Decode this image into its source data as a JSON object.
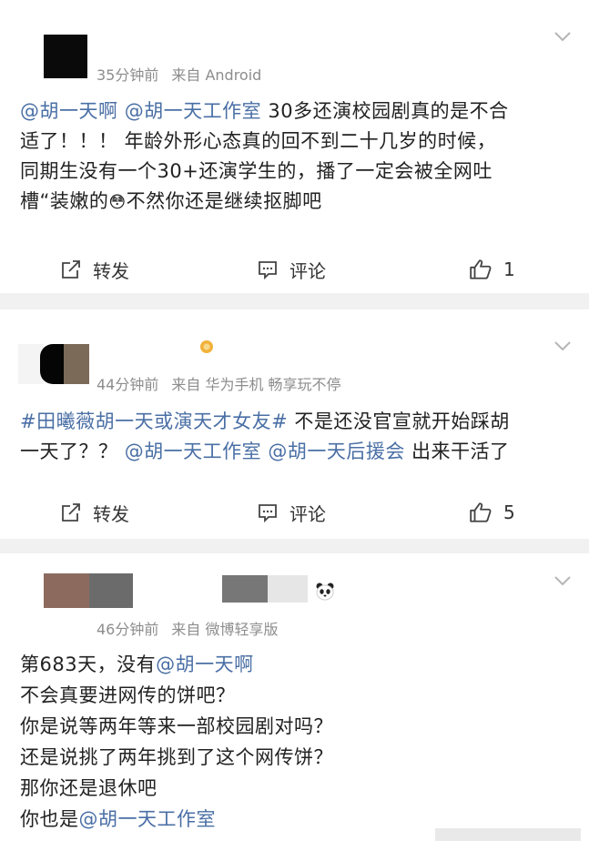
{
  "posts": [
    {
      "time": "35分钟前",
      "source": "来自 Android",
      "lines": [
        [
          {
            "t": "@胡一天啊",
            "link": true
          },
          {
            "t": " "
          },
          {
            "t": "@胡一天工作室",
            "link": true
          },
          {
            "t": " 30多还演校园剧真的是不合"
          }
        ],
        [
          {
            "t": "适了！！！ 年龄外形心态真的回不到二十几岁的时候，"
          }
        ],
        [
          {
            "t": "同期生没有一个30+还演学生的，播了一定会被全网吐"
          }
        ],
        [
          {
            "t": "槽“装嫩的"
          },
          {
            "t": "😳",
            "emoji": true
          },
          {
            "t": "不然你还是继续抠脚吧"
          }
        ]
      ],
      "repost_label": "转发",
      "comment_label": "评论",
      "like_count": "1"
    },
    {
      "time": "44分钟前",
      "source": "来自 华为手机 畅享玩不停",
      "lines": [
        [
          {
            "t": "#田曦薇胡一天或演天才女友#",
            "link": true
          },
          {
            "t": " 不是还没官宣就开始踩胡"
          }
        ],
        [
          {
            "t": "一天了？？ "
          },
          {
            "t": "@胡一天工作室",
            "link": true
          },
          {
            "t": " "
          },
          {
            "t": "@胡一天后援会",
            "link": true
          },
          {
            "t": " 出来干活了"
          }
        ]
      ],
      "repost_label": "转发",
      "comment_label": "评论",
      "like_count": "5"
    },
    {
      "time": "46分钟前",
      "source": "来自 微博轻享版",
      "lines": [
        [
          {
            "t": "第683天，没有"
          },
          {
            "t": "@胡一天啊",
            "link": true
          }
        ],
        [
          {
            "t": "不会真要进网传的饼吧？"
          }
        ],
        [
          {
            "t": "你是说等两年等来一部校园剧对吗？"
          }
        ],
        [
          {
            "t": "还是说挑了两年挑到了这个网传饼？"
          }
        ],
        [
          {
            "t": "那你还是退休吧"
          }
        ],
        [
          {
            "t": "你也是"
          },
          {
            "t": "@胡一天工作室",
            "link": true
          }
        ]
      ]
    }
  ],
  "colors": {
    "link": "#4a6fa5",
    "meta": "#8d8d8d",
    "separator": "#f1f1f1"
  },
  "icons": {
    "repost": "repost-icon",
    "comment": "comment-icon",
    "like": "thumbs-up-icon",
    "more": "chevron-down-icon"
  }
}
